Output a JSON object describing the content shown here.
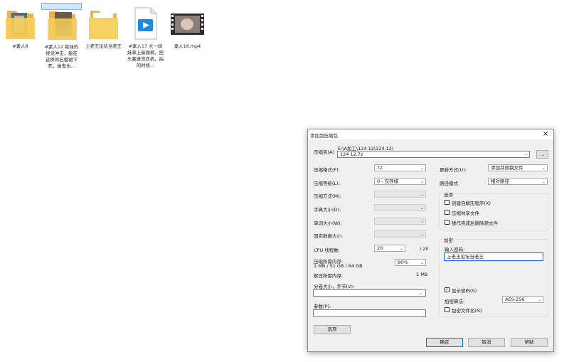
{
  "desktop": {
    "items": [
      {
        "label": "#素人8",
        "kind": "folder"
      },
      {
        "label": "#素人12  继妹的视觉冲击，能在这样的石榴裙下死，做鬼也...",
        "kind": "folder"
      },
      {
        "label": "上老王论坛当老王",
        "kind": "folder"
      },
      {
        "label": "#素人17  大一妹妹拿上瑜伽裤，把头塞进洗衣机，拍的时候...",
        "kind": "video-file"
      },
      {
        "label": "素人16.mp4",
        "kind": "video-thumb"
      }
    ]
  },
  "dialog": {
    "title": "添加到压缩包",
    "archive_label": "压缩包(A)",
    "archive_path": "E:\\A加工\\124 12\\124 12\\",
    "archive_name": "124 12.7z",
    "browse_label": "...",
    "format_label": "压缩格式(F):",
    "format_value": "7z",
    "level_label": "压缩等级(L):",
    "level_value": "0 - 仅存储",
    "method_label": "压缩方法(M):",
    "dict_label": "字典大小(D):",
    "word_label": "单词大小(W):",
    "solid_label": "固实数据大小:",
    "cpu_label": "CPU 线程数:",
    "cpu_value": "20",
    "cpu_total": "/ 20",
    "mem_label": "压缩所需内存:",
    "mem_detail": "1 MB / 51 GB / 64 GB",
    "mem_value": "80%",
    "decomp_label": "解压所需内存:",
    "decomp_value": "1 MB",
    "split_label": "分卷大小，字节(V):",
    "params_label": "参数(P):",
    "options_button": "选项",
    "update_label": "更新方式(U):",
    "update_value": "添加并替换文件",
    "pathmode_label": "路径模式",
    "pathmode_value": "相对路径",
    "options_group": "选项",
    "opt_sfx": "创建自解压程序(X)",
    "opt_shared": "压缩共享文件",
    "opt_delete": "操作完成后删除源文件",
    "encrypt_group": "加密",
    "password_label": "输入密码:",
    "password_value": "上老王论坛当老王",
    "show_password": "显示密码(S)",
    "enc_method_label": "加密算法:",
    "enc_method_value": "AES-256",
    "encrypt_names": "加密文件名(N)",
    "ok": "确定",
    "cancel": "取消",
    "help": "帮助",
    "close": "×"
  }
}
